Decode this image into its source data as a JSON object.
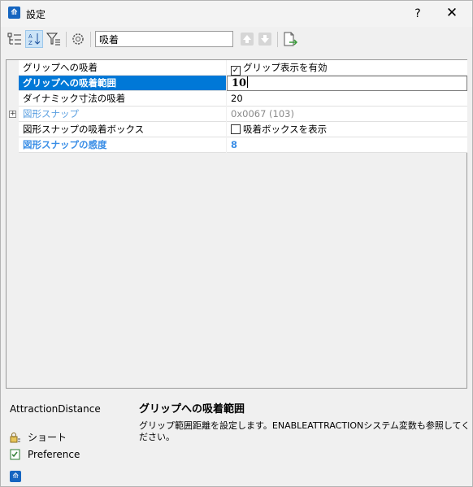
{
  "window": {
    "title": "設定",
    "help_label": "?",
    "close_label": "✕"
  },
  "toolbar": {
    "search_value": "吸着"
  },
  "grid": {
    "rows": [
      {
        "name": "グリップへの吸着",
        "value": "グリップ表示を有効",
        "checkbox": true,
        "checked": true
      },
      {
        "name": "グリップへの吸着範囲",
        "value": "10",
        "selected": true
      },
      {
        "name": "ダイナミック寸法の吸着",
        "value": "20"
      },
      {
        "name": "図形スナップ",
        "value": "0x0067 (103)",
        "expandable": true
      },
      {
        "name": "図形スナップの吸着ボックス",
        "value": "吸着ボックスを表示",
        "checkbox": true,
        "checked": false
      },
      {
        "name": "図形スナップの感度",
        "value": "8",
        "modified": true
      }
    ]
  },
  "description": {
    "variable": "AttractionDistance",
    "title": "グリップへの吸着範囲",
    "text": "グリップ範囲距離を設定します。ENABLEATTRACTIONシステム変数も参照してください。"
  },
  "info": {
    "shortcut_label": "ショート",
    "preference_label": "Preference"
  },
  "colors": {
    "accent": "#0078d7",
    "modified": "#3a8ee6",
    "app_icon": "#1565c0"
  }
}
